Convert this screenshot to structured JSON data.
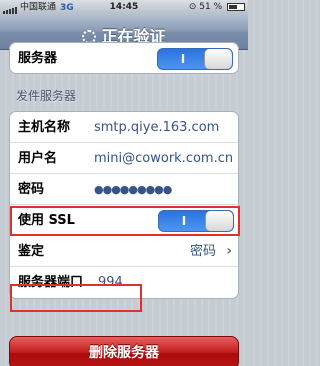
{
  "status_bar": {
    "carrier": "中国联通",
    "network": "3G",
    "time": "14:45",
    "battery": "51 %"
  },
  "nav": {
    "title": "正在验证"
  },
  "top_group": {
    "server_label": "服务器",
    "server_toggle": "I"
  },
  "outgoing": {
    "section_title": "发件服务器",
    "host_label": "主机名称",
    "host_value": "smtp.qiye.163.com",
    "user_label": "用户名",
    "user_value": "mini@cowork.com.cn",
    "password_label": "密码",
    "password_value": "●●●●●●●●●",
    "ssl_label": "使用 SSL",
    "ssl_toggle": "I",
    "auth_label": "鉴定",
    "auth_value": "密码",
    "port_label": "服务器端口",
    "port_value": "994"
  },
  "delete_button": "删除服务器",
  "colors": {
    "highlight_box": "#e03030",
    "toggle_on": "#2b73de",
    "delete_button": "#c01a1a"
  }
}
